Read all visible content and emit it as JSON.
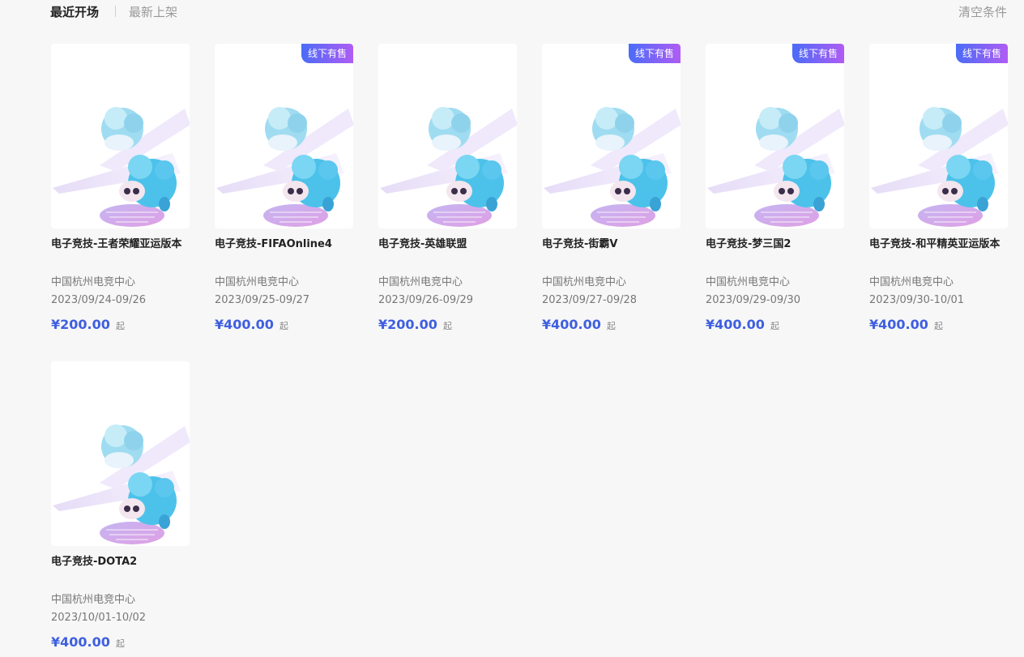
{
  "toolbar": {
    "sort_tabs": [
      "最近开场",
      "最新上架"
    ],
    "clear_label": "清空条件"
  },
  "events": [
    {
      "title": "电子竞技-王者荣耀亚运版本",
      "venue": "中国杭州电竞中心",
      "dates": "2023/09/24-09/26",
      "price": "¥200.00",
      "price_suffix": "起",
      "badge": ""
    },
    {
      "title": "电子竞技-FIFAOnline4",
      "venue": "中国杭州电竞中心",
      "dates": "2023/09/25-09/27",
      "price": "¥400.00",
      "price_suffix": "起",
      "badge": "线下有售"
    },
    {
      "title": "电子竞技-英雄联盟",
      "venue": "中国杭州电竞中心",
      "dates": "2023/09/26-09/29",
      "price": "¥200.00",
      "price_suffix": "起",
      "badge": ""
    },
    {
      "title": "电子竞技-街霸V",
      "venue": "中国杭州电竞中心",
      "dates": "2023/09/27-09/28",
      "price": "¥400.00",
      "price_suffix": "起",
      "badge": "线下有售"
    },
    {
      "title": "电子竞技-梦三国2",
      "venue": "中国杭州电竞中心",
      "dates": "2023/09/29-09/30",
      "price": "¥400.00",
      "price_suffix": "起",
      "badge": "线下有售"
    },
    {
      "title": "电子竞技-和平精英亚运版本",
      "venue": "中国杭州电竞中心",
      "dates": "2023/09/30-10/01",
      "price": "¥400.00",
      "price_suffix": "起",
      "badge": "线下有售"
    },
    {
      "title": "电子竞技-DOTA2",
      "venue": "中国杭州电竞中心",
      "dates": "2023/10/01-10/02",
      "price": "¥400.00",
      "price_suffix": "起",
      "badge": ""
    }
  ]
}
